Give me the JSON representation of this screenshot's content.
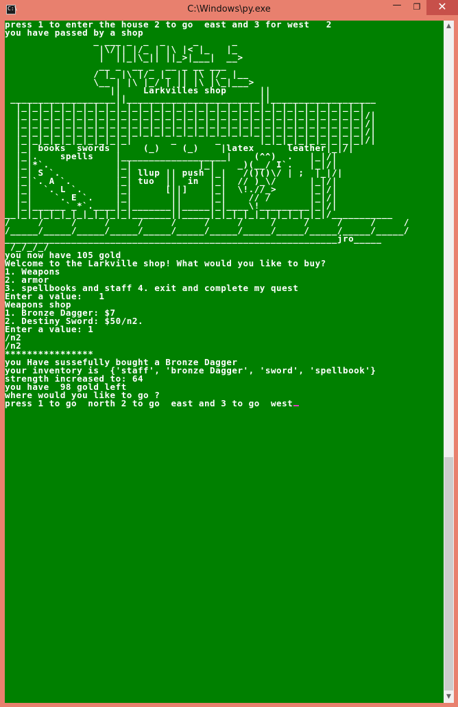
{
  "window": {
    "title": "C:\\Windows\\py.exe",
    "icon_text": "C:\\"
  },
  "controls": {
    "minimize": "—",
    "maximize": "❐",
    "close": "✕"
  },
  "scrollbar": {
    "up": "▲",
    "down": "▼"
  },
  "console": {
    "text": "press 1 to enter the house 2 to go  east and 3 for west   2\nyou have passed by a shop\n                _ ___ _  _  _     _      _\n                 |\\/|| |/_ | |\\ |< |_   |_\n                 |  ||_|\\_|| ||_>|___|  __>\n                 __ _  __ _  __ _ __ ___\n                / |_ |\\ |/_ |_ || |\\ |/_ |__\n                \\__ | |\\ |_/ | || |\\ |\\_|___>\n                   ||    Larkvilles shop      ||\n ___________________||________________________||___________________\n  |_|_|_|_|_|_|_|_|_|_|_|_|_|_|_|_|_|_|_|_|_|_|_|_|_|_|_|_|_|_|_|\n  |_|_|_|_|_|_|_|_|_|_|_|_|_|_|_|_|_|_|_|_|_|_|_|_|_|_|_|_|_|_|_|/|\n  |_|_|_|_|_|_|_|_|_|_|_|_|_|_|_|_|_|_|_|_|_|_|_|_|_|_|_|_|_|_|_|/|\n  |_|_|_|_|_|_|_|_|_|_|_|_|_|_|_|_|_|_|_|_|_|_|_|_|_|_|_|_|_|_|_|/|\n  |_|_|_|_|_|_|_|_|_|_|       _       _       |_|_|_|_|_|_|_|_|_|/|\n  |_| books  swords |    (_)    (_)    |latex      leather|_|/|\n  |_|.    spells    |___________________|    (^^)  .   |_|/|\n  |_|*`.            |_|            |_|    _)(__/ I`.   |_|/|\n  |_| S `.          |_| llup || push |_|   /()()\\/ | ;  |_|/|\n  |_|`. A `.        |_| tuo  ||  in  |_|  // )_\\/      |_|/|\n  |_|  `. L `.      |_|      [||]    |_|  \\!.//_>      |_|/|\n  |_|    `. E `.    |_|       ||     |_|    // /       |_|/|\n  |_|______`_*`.____|_|_______||_____|_|____\\!_________|_|/|\n__|_|_|_|_|_|_|_|_|_|_|_______||_____|_|_|_|_|_|_|_|_|_|_|/___________\n/     /     /     /     /     /     /     /     /     /     /     /     /\n/_____/_____/_____/_____/_____/_____/_____/_____/_____/_____/_____/_____/\n____________________________________________________________jro_____\n /_/_/_/\nyou now have 105 gold\nWelcome to the Larkville shop! What would you like to buy?\n1. Weapons\n2. armor\n3. spellbooks and staff 4. exit and complete my quest\nEnter a value:   1\nWeapons shop\n1. Bronze Dagger: $7\n2. Destiny Sword: $50/n2.\nEnter a value: 1\n/n2\n/n2\n****************\nyou Have sussefully bought a Bronze Dagger\nyour inventory is  {'staff', 'bronze Dagger', 'sword', 'spellbook'}\nstrength increased to: 64\nyou have  98 gold left\nwhere would you like to go ?\npress 1 to go  north 2 to go  east and 3 to go  west"
  },
  "colors": {
    "console_bg": "#008000",
    "console_fg": "#ffffff",
    "titlebar": "#e8806e",
    "close_button": "#c7504a",
    "cursor": "#e040c0"
  }
}
